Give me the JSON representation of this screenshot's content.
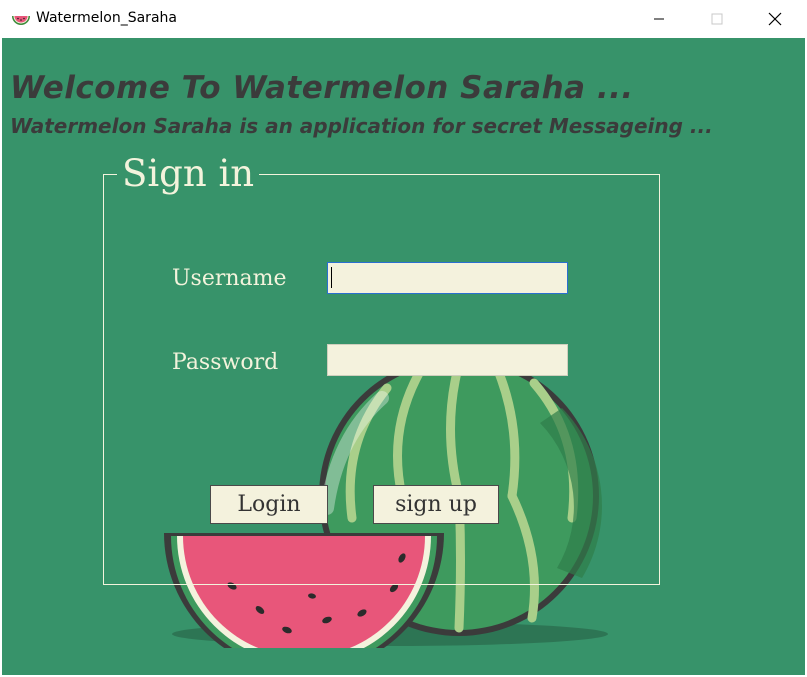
{
  "window": {
    "title": "Watermelon_Saraha",
    "icon": "watermelon-slice-icon",
    "controls": [
      "minimize-icon",
      "maximize-icon",
      "close-icon"
    ]
  },
  "header": {
    "title": "Welcome To Watermelon Saraha ...",
    "subtitle": "Watermelon Saraha is an application for secret Messageing ..."
  },
  "signin": {
    "legend": "Sign in",
    "username_label": "Username",
    "username_value": "",
    "password_label": "Password",
    "password_value": "",
    "login_label": "Login",
    "signup_label": "sign up"
  },
  "colors": {
    "background": "#37936a",
    "text_light": "#f3f3dc",
    "text_dark": "#3b3b3b",
    "field_bg": "#f4f2dd",
    "melon_flesh": "#e8567a"
  }
}
